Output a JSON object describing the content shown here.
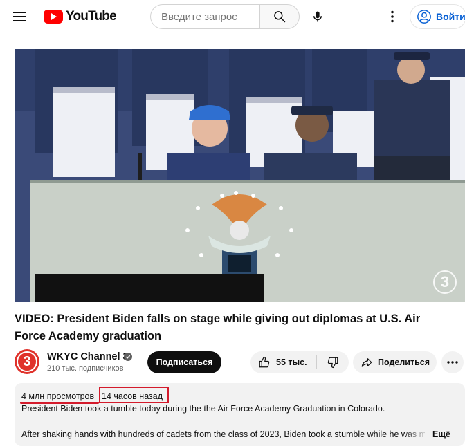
{
  "header": {
    "logo_text": "YouTube",
    "search_placeholder": "Введите запрос",
    "signin_label": "Войти"
  },
  "video": {
    "title": "VIDEO: President Biden falls on stage while giving out diplomas at U.S. Air Force Academy graduation",
    "watermark": "3"
  },
  "channel": {
    "name": "WKYC Channel 3",
    "avatar_text": "3",
    "subscribers": "210 тыс. подписчиков",
    "subscribe_label": "Подписаться"
  },
  "actions": {
    "likes": "55 тыс.",
    "share_label": "Поделиться"
  },
  "description": {
    "views": "4 млн просмотров",
    "time": "14 часов назад",
    "line1": "President Biden took a tumble today during the the Air Force Academy Graduation in Colorado.",
    "line2": "After shaking hands with hundreds of cadets from the class of 2023, Biden took a stumble while he was making his way back to his seat.",
    "more_label": "Ещё"
  },
  "colors": {
    "youtube_red": "#ff0000",
    "link_blue": "#065fd4",
    "highlight_red": "#d41b2c",
    "chip_gray": "#f2f2f2"
  }
}
